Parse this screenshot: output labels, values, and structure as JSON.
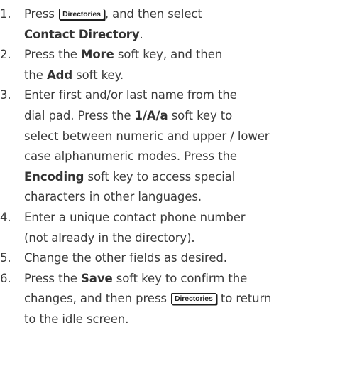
{
  "steps": [
    {
      "number": "1.",
      "parts": [
        "Press ",
        "Directories",
        ", and then select",
        "Contact Directory",
        "."
      ]
    },
    {
      "number": "2.",
      "parts": [
        "Press the ",
        "More",
        " soft key, and then",
        "the ",
        "Add",
        " soft key."
      ]
    },
    {
      "number": "3.",
      "parts": [
        "Enter first and/or last name from the",
        "dial pad. Press the ",
        "1/A/a",
        " soft key to",
        "select between numeric and upper / lower",
        "case alphanumeric modes. Press the",
        "Encoding",
        " soft key to access special",
        "characters in other languages."
      ]
    },
    {
      "number": "4.",
      "parts": [
        "Enter a unique contact phone number",
        "(not already in the directory)."
      ]
    },
    {
      "number": "5.",
      "parts": [
        "Change the other fields as desired."
      ]
    },
    {
      "number": "6.",
      "parts": [
        "Press the ",
        "Save",
        " soft key to confirm the",
        "changes, and then press ",
        "Directories",
        " to return",
        "to the idle screen."
      ]
    }
  ]
}
